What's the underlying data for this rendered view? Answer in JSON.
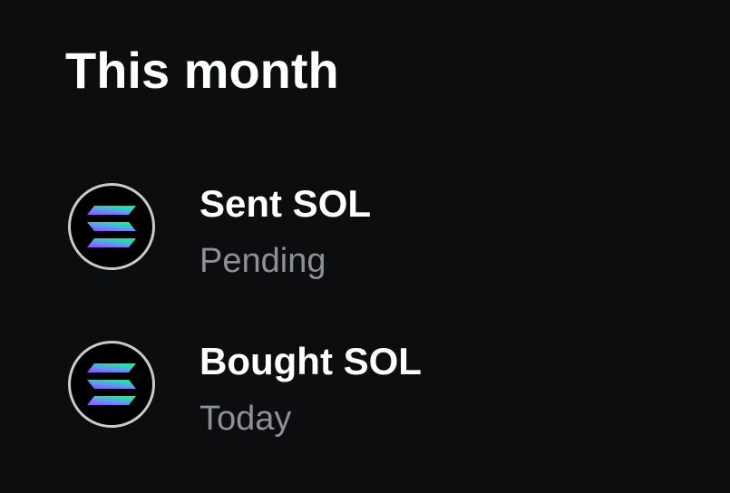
{
  "section": {
    "title": "This month"
  },
  "transactions": [
    {
      "title": "Sent SOL",
      "status": "Pending",
      "icon": "solana-logo-icon"
    },
    {
      "title": "Bought SOL",
      "status": "Today",
      "icon": "solana-logo-icon"
    }
  ],
  "colors": {
    "background": "#0c0d0f",
    "title_text": "#ffffff",
    "subtitle_text": "#8c9098",
    "avatar_ring": "#c9cacd",
    "solana_gradient_start": "#9945ff",
    "solana_gradient_end": "#14f195"
  }
}
